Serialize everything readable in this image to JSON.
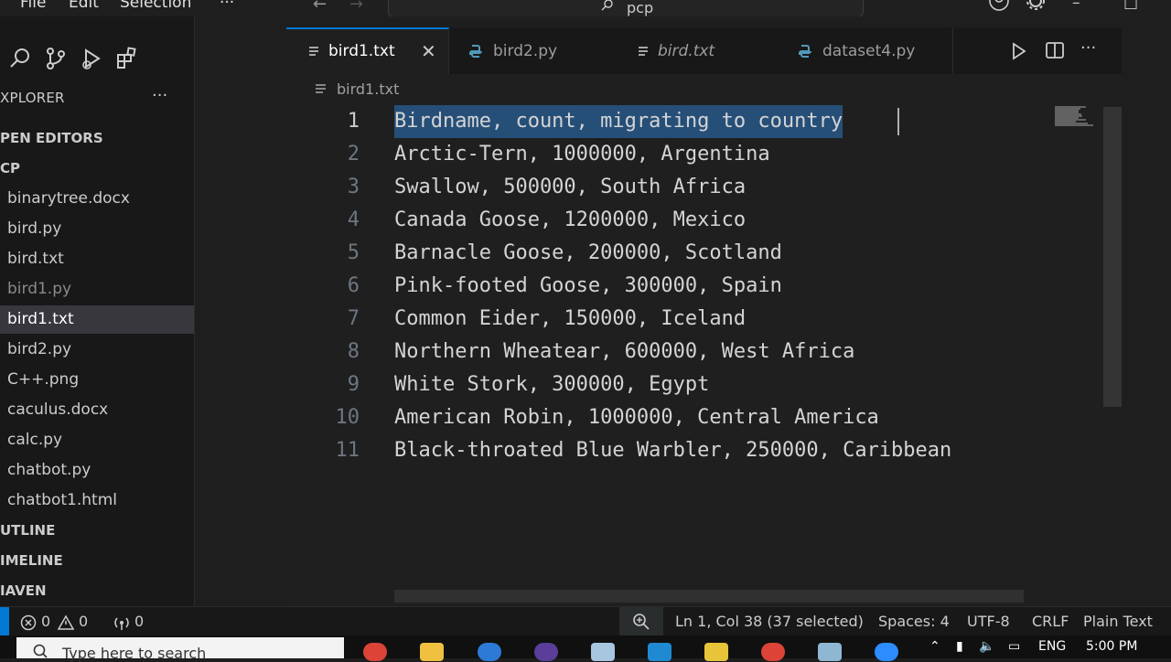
{
  "titlebar": {
    "menu": [
      "File",
      "Edit",
      "Selection",
      "···"
    ],
    "search_text": "pcp"
  },
  "explorer": {
    "title": "XPLORER",
    "more": "···",
    "open_editors": "PEN EDITORS",
    "folder": "CP",
    "files": [
      {
        "name": "binarytree.docx"
      },
      {
        "name": "bird.py"
      },
      {
        "name": "bird.txt"
      },
      {
        "name": "bird1.py"
      },
      {
        "name": "bird1.txt"
      },
      {
        "name": "bird2.py"
      },
      {
        "name": "C++.png"
      },
      {
        "name": "caculus.docx"
      },
      {
        "name": "calc.py"
      },
      {
        "name": "chatbot.py"
      },
      {
        "name": "chatbot1.html"
      }
    ],
    "outline": "UTLINE",
    "timeline": "IMELINE",
    "maven": "IAVEN"
  },
  "tabs": [
    {
      "label": "bird1.txt",
      "close": "✕"
    },
    {
      "label": "bird2.py"
    },
    {
      "label": "bird.txt"
    },
    {
      "label": "dataset4.py"
    }
  ],
  "breadcrumb": "bird1.txt",
  "editor": {
    "lines": [
      {
        "num": "1",
        "text": "Birdname, count, migrating to country"
      },
      {
        "num": "2",
        "text": "Arctic-Tern, 1000000, Argentina"
      },
      {
        "num": "3",
        "text": "Swallow, 500000, South Africa"
      },
      {
        "num": "4",
        "text": "Canada Goose, 1200000, Mexico"
      },
      {
        "num": "5",
        "text": "Barnacle Goose, 200000, Scotland"
      },
      {
        "num": "6",
        "text": "Pink-footed Goose, 300000, Spain"
      },
      {
        "num": "7",
        "text": "Common Eider, 150000, Iceland"
      },
      {
        "num": "8",
        "text": "Northern Wheatear, 600000, West Africa"
      },
      {
        "num": "9",
        "text": "White Stork, 300000, Egypt"
      },
      {
        "num": "10",
        "text": "American Robin, 1000000, Central America"
      },
      {
        "num": "11",
        "text": "Black-throated Blue Warbler, 250000, Caribbean"
      }
    ]
  },
  "statusbar": {
    "errors": "0",
    "warnings": "0",
    "ports": "0",
    "position": "Ln 1, Col 38 (37 selected)",
    "spaces": "Spaces: 4",
    "encoding": "UTF-8",
    "eol": "CRLF",
    "language": "Plain Text"
  },
  "taskbar": {
    "search_placeholder": "Type here to search",
    "lang": "ENG",
    "time": "5:00 PM"
  },
  "colors": {
    "accent": "#0078d4",
    "selection": "#264f78",
    "python_icon": "#519aba"
  }
}
